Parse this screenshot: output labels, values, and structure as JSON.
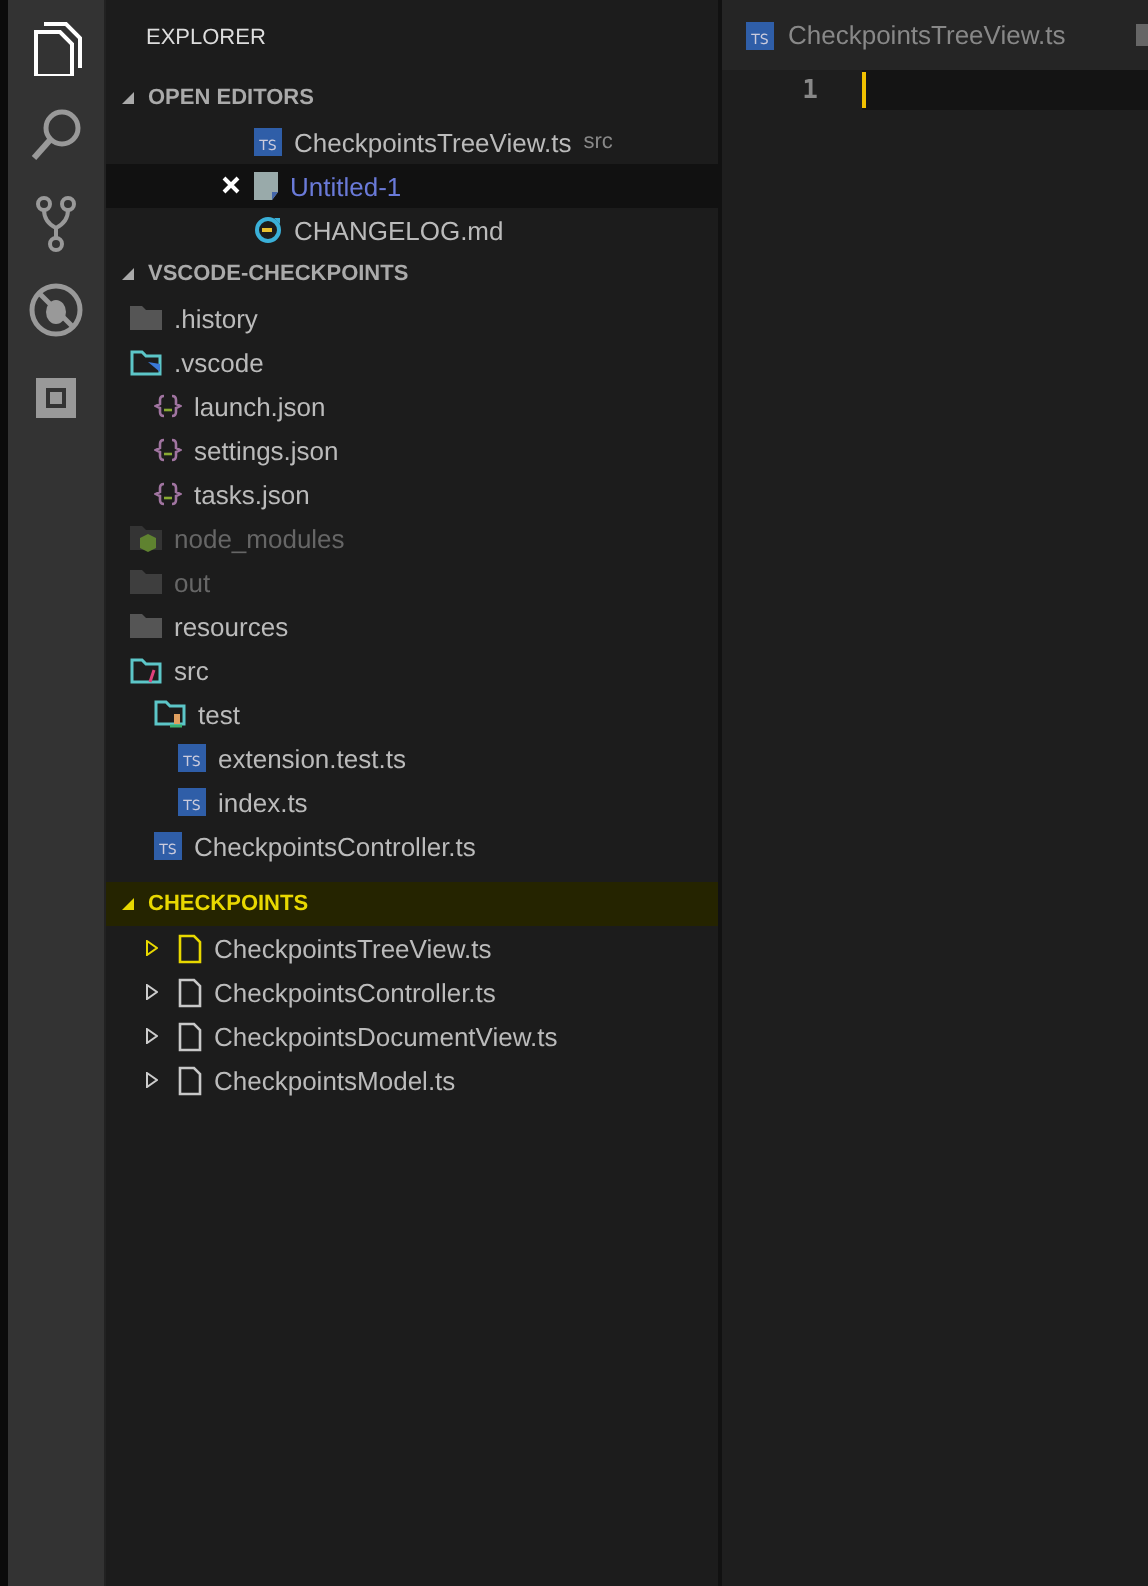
{
  "activity_bar": [
    {
      "kind": "files",
      "selected": true
    },
    {
      "kind": "search",
      "selected": false
    },
    {
      "kind": "git",
      "selected": false
    },
    {
      "kind": "debug",
      "selected": false
    },
    {
      "kind": "extensions",
      "selected": false
    }
  ],
  "sidebar": {
    "title": "EXPLORER",
    "open_editors": {
      "title": "OPEN EDITORS",
      "expanded": true,
      "items": [
        {
          "name": "CheckpointsTreeView.ts",
          "kind": "ts",
          "badge": "TS",
          "detail": "src",
          "selected": false,
          "dirty": false
        },
        {
          "name": "Untitled-1",
          "kind": "untitled",
          "selected": true,
          "dirty": true
        },
        {
          "name": "CHANGELOG.md",
          "kind": "changelog",
          "selected": false,
          "dirty": false
        }
      ]
    },
    "project": {
      "title": "VSCODE-CHECKPOINTS",
      "expanded": true,
      "tree": [
        {
          "name": ".history",
          "kind": "folder",
          "dimmed": false
        },
        {
          "name": ".vscode",
          "kind": "folder-vscode",
          "dimmed": false,
          "children": [
            {
              "name": "launch.json",
              "kind": "json",
              "dimmed": false
            },
            {
              "name": "settings.json",
              "kind": "json",
              "dimmed": false
            },
            {
              "name": "tasks.json",
              "kind": "json",
              "dimmed": false
            }
          ]
        },
        {
          "name": "node_modules",
          "kind": "folder-node",
          "dimmed": true
        },
        {
          "name": "out",
          "kind": "folder",
          "dimmed": true
        },
        {
          "name": "resources",
          "kind": "folder",
          "dimmed": false
        },
        {
          "name": "src",
          "kind": "folder-src",
          "dimmed": false,
          "children": [
            {
              "name": "test",
              "kind": "folder-test",
              "dimmed": false,
              "children": [
                {
                  "name": "extension.test.ts",
                  "kind": "ts",
                  "badge": "TS",
                  "dimmed": false
                },
                {
                  "name": "index.ts",
                  "kind": "ts",
                  "badge": "TS",
                  "dimmed": false
                }
              ]
            },
            {
              "name": "CheckpointsController.ts",
              "kind": "ts",
              "badge": "TS",
              "dimmed": false
            }
          ]
        }
      ]
    },
    "checkpoints": {
      "title": "CHECKPOINTS",
      "expanded": true,
      "highlighted": true,
      "items": [
        {
          "name": "CheckpointsTreeView.ts",
          "selected": true
        },
        {
          "name": "CheckpointsController.ts",
          "selected": false
        },
        {
          "name": "CheckpointsDocumentView.ts",
          "selected": false
        },
        {
          "name": "CheckpointsModel.ts",
          "selected": false
        }
      ]
    }
  },
  "editor": {
    "tabs": [
      {
        "label": "CheckpointsTreeView.ts",
        "kind": "ts",
        "badge": "TS",
        "selected": false
      }
    ],
    "line_numbers": [
      "1"
    ]
  }
}
